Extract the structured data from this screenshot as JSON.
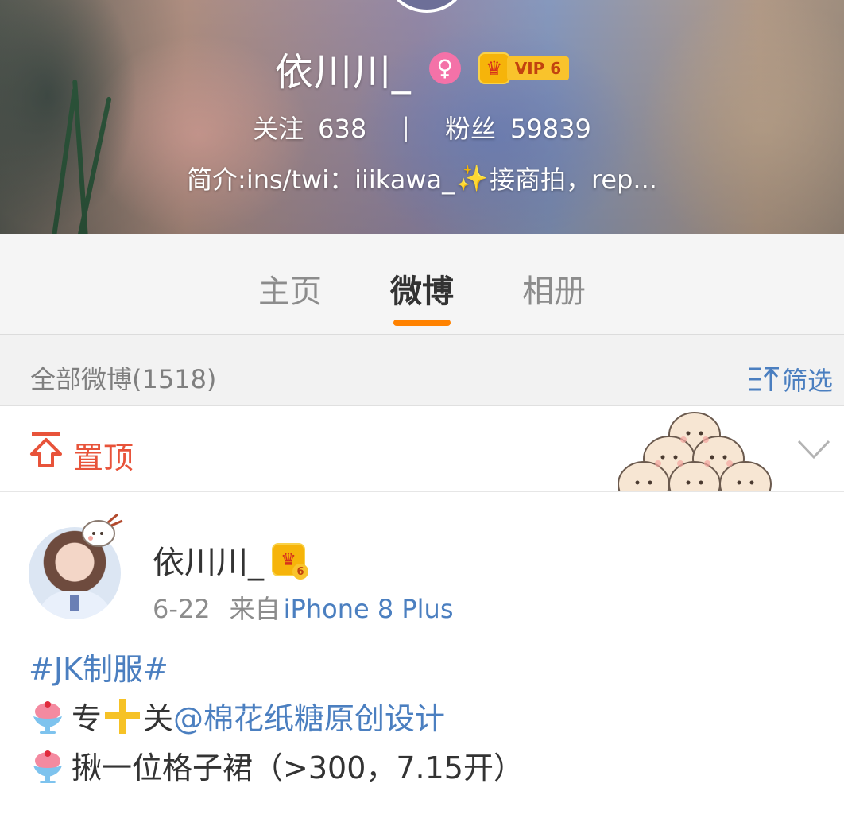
{
  "profile": {
    "name": "依川川_",
    "vip_label": "VIP 6",
    "following_label": "关注",
    "following_count": "638",
    "stats_separator": "|",
    "followers_label": "粉丝",
    "followers_count": "59839",
    "intro_prefix": "简介:ins/twi：iiikawa_",
    "intro_suffix": "接商拍，rep..."
  },
  "tabs": [
    {
      "label": "主页",
      "active": false
    },
    {
      "label": "微博",
      "active": true
    },
    {
      "label": "相册",
      "active": false
    }
  ],
  "filter_bar": {
    "title": "全部微博(1518)",
    "filter_label": "筛选"
  },
  "pinned": {
    "label": "置顶"
  },
  "post": {
    "author": "依川川_",
    "level_badge": "6",
    "date": "6-22",
    "source_prefix": "来自",
    "source": "iPhone 8 Plus",
    "hashtag": "#JK制服#",
    "line1_a": "专",
    "line1_b": "关",
    "mention": "@棉花纸糖原创设计",
    "line2": "揪一位格子裙（>300，7.15开）"
  },
  "colors": {
    "accent_orange": "#ff8200",
    "link_blue": "#4b7fc0",
    "pin_red": "#e8533a",
    "gender_pink": "#f472a8",
    "vip_gold": "#f9c32c"
  },
  "icons": [
    "gender-female-icon",
    "vip-crown-icon",
    "filter-icon",
    "pin-top-icon",
    "chevron-down-icon",
    "shaved-ice-emoji-icon",
    "plus-cross-emoji-icon"
  ]
}
